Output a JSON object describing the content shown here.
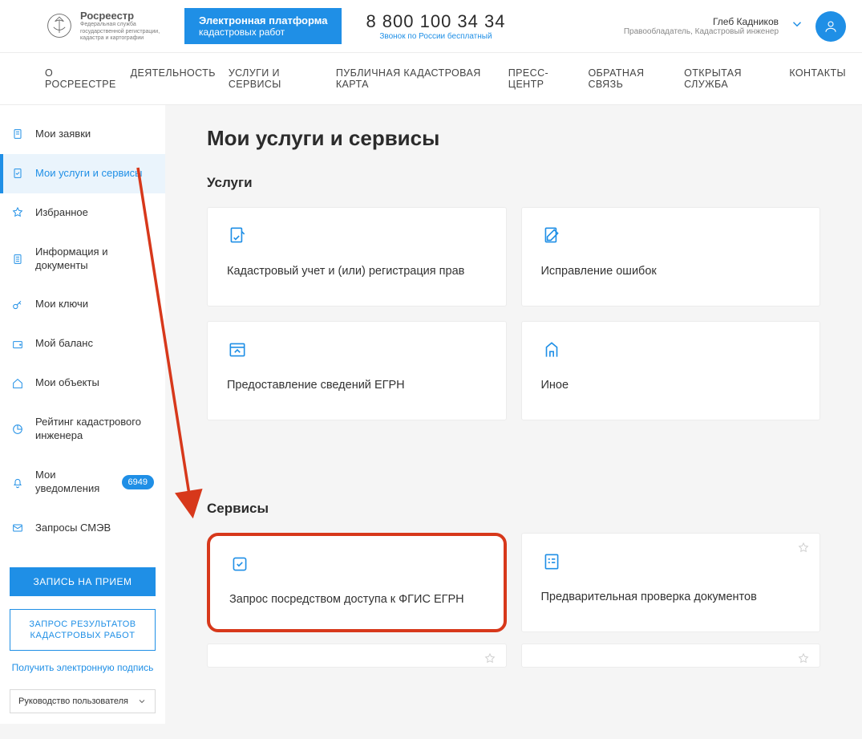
{
  "header": {
    "logo_name": "Росреестр",
    "logo_sub": "Федеральная служба государственной регистрации, кадастра и картографии",
    "platform_l1": "Электронная платформа",
    "platform_l2": "кадастровых работ",
    "phone": "8 800 100 34 34",
    "phone_sub": "Звонок по России бесплатный",
    "user_name": "Глеб Кадников",
    "user_role": "Правообладатель, Кадастровый инженер"
  },
  "nav": {
    "items": [
      "О РОСРЕЕСТРЕ",
      "ДЕЯТЕЛЬНОСТЬ",
      "УСЛУГИ И СЕРВИСЫ",
      "ПУБЛИЧНАЯ КАДАСТРОВАЯ КАРТА",
      "ПРЕСС-ЦЕНТР",
      "ОБРАТНАЯ СВЯЗЬ",
      "ОТКРЫТАЯ СЛУЖБА",
      "КОНТАКТЫ"
    ]
  },
  "sidebar": {
    "items": [
      {
        "label": "Мои заявки"
      },
      {
        "label": "Мои услуги и сервисы"
      },
      {
        "label": "Избранное"
      },
      {
        "label": "Информация и документы"
      },
      {
        "label": "Мои ключи"
      },
      {
        "label": "Мой баланс"
      },
      {
        "label": "Мои объекты"
      },
      {
        "label": "Рейтинг кадастрового инженера"
      },
      {
        "label": "Мои уведомления",
        "badge": "6949"
      },
      {
        "label": "Запросы СМЭВ"
      }
    ],
    "btn_appointment": "ЗАПИСЬ НА ПРИЕМ",
    "btn_results": "ЗАПРОС РЕЗУЛЬТАТОВ КАДАСТРОВЫХ РАБОТ",
    "link_signature": "Получить электронную подпись",
    "select_guide": "Руководство пользователя"
  },
  "main": {
    "title": "Мои услуги и сервисы",
    "section_services": "Услуги",
    "section_serv": "Сервисы",
    "cards_services": [
      {
        "title": "Кадастровый учет и (или) регистрация прав"
      },
      {
        "title": "Исправление ошибок"
      },
      {
        "title": "Предоставление сведений ЕГРН"
      },
      {
        "title": "Иное"
      }
    ],
    "cards_serv": [
      {
        "title": "Запрос посредством доступа к ФГИС ЕГРН"
      },
      {
        "title": "Предварительная проверка документов"
      }
    ]
  }
}
